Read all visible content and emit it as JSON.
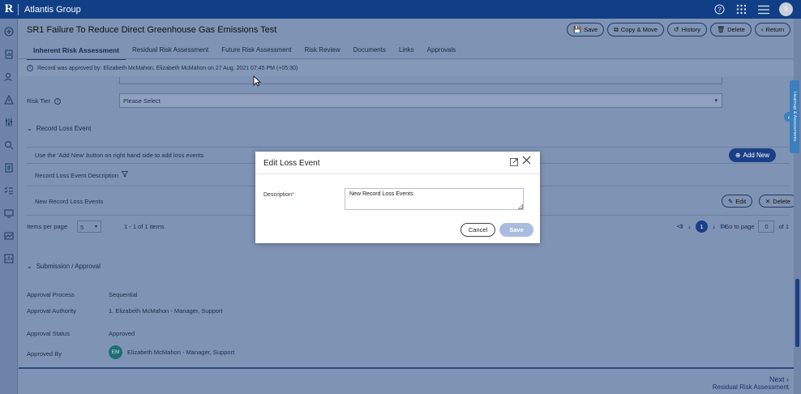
{
  "topbar": {
    "logo": "R",
    "app_title": "Atlantis Group",
    "user_initial": "S"
  },
  "record": {
    "title": "SR1 Failure To Reduce Direct Greenhouse Gas Emissions Test"
  },
  "actions": [
    {
      "label": "Save",
      "icon": "save-icon"
    },
    {
      "label": "Copy & Move",
      "icon": "copy-icon"
    },
    {
      "label": "History",
      "icon": "history-icon"
    },
    {
      "label": "Delete",
      "icon": "trash-icon"
    },
    {
      "label": "Return",
      "icon": "chevron-left-icon"
    }
  ],
  "tabs": [
    {
      "label": "Inherent Risk Assessment",
      "active": true
    },
    {
      "label": "Residual Risk Assessment"
    },
    {
      "label": "Future Risk Assessment"
    },
    {
      "label": "Risk Review"
    },
    {
      "label": "Documents"
    },
    {
      "label": "Links"
    },
    {
      "label": "Approvals"
    }
  ],
  "notice": "Record was approved by: Elizabeth McMahon, Elizabeth McMahon on 27 Aug, 2021 07:45 PM (+05:30)",
  "risk_tier": {
    "label": "Risk Tier",
    "value": "Please Select"
  },
  "loss_event": {
    "section_title": "Record Loss Event",
    "hint": "Use the 'Add New' button on right hand side to add loss events",
    "add_new_label": "Add New",
    "column_header": "Record Loss Event Description",
    "rows": [
      {
        "description": "New Record Loss Events",
        "edit_label": "Edit",
        "delete_label": "Delete"
      }
    ]
  },
  "pager": {
    "items_per_page_label": "Items per page",
    "items_per_page": "5",
    "range_text": "1 - 1 of 1 items",
    "current_page": "1",
    "goto_label": "Go to page",
    "goto_value": "0",
    "of_text": "of 1"
  },
  "submission": {
    "section_title": "Submission / Approval",
    "rows": [
      {
        "label": "Approval Process",
        "value": "Sequential"
      },
      {
        "label": "Approval Authority",
        "value": "1. Elizabeth McMahon - Manager, Support"
      },
      {
        "label": "Approval Status",
        "value": "Approved"
      },
      {
        "label": "Approved By",
        "value": "Elizabeth McMahon - Manager, Support",
        "avatar": "EM"
      }
    ]
  },
  "footer": {
    "next_label": "Next",
    "next_target": "Residual Risk Assessment"
  },
  "side_tab": "Heatmap & Assessments",
  "modal": {
    "title": "Edit Loss Event",
    "description_label": "Description",
    "required_mark": "*",
    "description_value": "New Record Loss Events",
    "cancel_label": "Cancel",
    "save_label": "Save"
  },
  "colors": {
    "topbar": "#103f86",
    "accent": "#1a3f86",
    "overlay_bg": "#7f93b4",
    "save_disabled": "#a9bce0"
  }
}
